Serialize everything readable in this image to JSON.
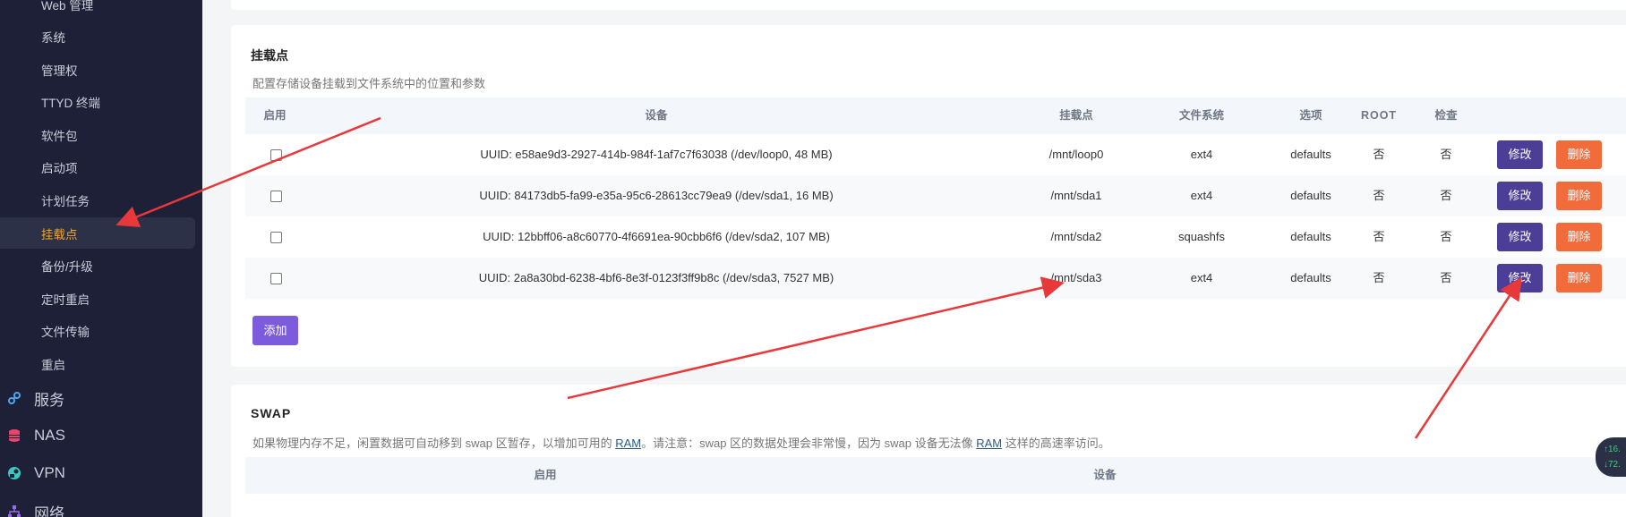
{
  "sidebar": {
    "sub_items": [
      {
        "label": "Web 管理",
        "name": "sidebar-item-web-admin"
      },
      {
        "label": "系统",
        "name": "sidebar-item-system"
      },
      {
        "label": "管理权",
        "name": "sidebar-item-admin-rights"
      },
      {
        "label": "TTYD 终端",
        "name": "sidebar-item-ttyd"
      },
      {
        "label": "软件包",
        "name": "sidebar-item-packages"
      },
      {
        "label": "启动项",
        "name": "sidebar-item-startup"
      },
      {
        "label": "计划任务",
        "name": "sidebar-item-scheduled-tasks"
      },
      {
        "label": "挂载点",
        "name": "sidebar-item-mount-points"
      },
      {
        "label": "备份/升级",
        "name": "sidebar-item-backup"
      },
      {
        "label": "定时重启",
        "name": "sidebar-item-timed-reboot"
      },
      {
        "label": "文件传输",
        "name": "sidebar-item-file-transfer"
      },
      {
        "label": "重启",
        "name": "sidebar-item-reboot"
      }
    ],
    "main_items": [
      {
        "label": "服务",
        "icon": "services-icon"
      },
      {
        "label": "NAS",
        "icon": "database-icon"
      },
      {
        "label": "VPN",
        "icon": "vpn-icon"
      },
      {
        "label": "网络",
        "icon": "network-icon"
      }
    ],
    "active_index": 7,
    "active_color": "#f5a623"
  },
  "mount": {
    "title": "挂载点",
    "description": "配置存储设备挂载到文件系统中的位置和参数",
    "headers": {
      "enabled": "启用",
      "device": "设备",
      "mountpoint": "挂载点",
      "filesystem": "文件系统",
      "options": "选项",
      "root": "ROOT",
      "check": "检查"
    },
    "rows": [
      {
        "device": "UUID: e58ae9d3-2927-414b-984f-1af7c7f63038 (/dev/loop0, 48 MB)",
        "mountpoint": "/mnt/loop0",
        "filesystem": "ext4",
        "options": "defaults",
        "root": "否",
        "check": "否"
      },
      {
        "device": "UUID: 84173db5-fa99-e35a-95c6-28613cc79ea9 (/dev/sda1, 16 MB)",
        "mountpoint": "/mnt/sda1",
        "filesystem": "ext4",
        "options": "defaults",
        "root": "否",
        "check": "否"
      },
      {
        "device": "UUID: 12bbff06-a8c60770-4f6691ea-90cbb6f6 (/dev/sda2, 107 MB)",
        "mountpoint": "/mnt/sda2",
        "filesystem": "squashfs",
        "options": "defaults",
        "root": "否",
        "check": "否"
      },
      {
        "device": "UUID: 2a8a30bd-6238-4bf6-8e3f-0123f3ff9b8c (/dev/sda3, 7527 MB)",
        "mountpoint": "/mnt/sda3",
        "filesystem": "ext4",
        "options": "defaults",
        "root": "否",
        "check": "否"
      }
    ],
    "edit_label": "修改",
    "delete_label": "删除",
    "add_label": "添加"
  },
  "swap": {
    "title": "SWAP",
    "desc_part1": "如果物理内存不足，闲置数据可自动移到 swap 区暂存，以增加可用的 ",
    "desc_link1": "RAM",
    "desc_part2": "。请注意：swap 区的数据处理会非常慢，因为 swap 设备无法像 ",
    "desc_link2": "RAM",
    "desc_part3": " 这样的高速率访问。",
    "headers": {
      "enabled": "启用",
      "device": "设备"
    }
  },
  "speed_widget": {
    "up": "↑16.",
    "down": "↓72."
  },
  "colors": {
    "sidebar_bg": "#1d2036",
    "edit_button": "#4c3d96",
    "delete_button": "#f26b3a",
    "add_button": "#7c5cdc",
    "annotation_arrow": "#e8383a"
  }
}
